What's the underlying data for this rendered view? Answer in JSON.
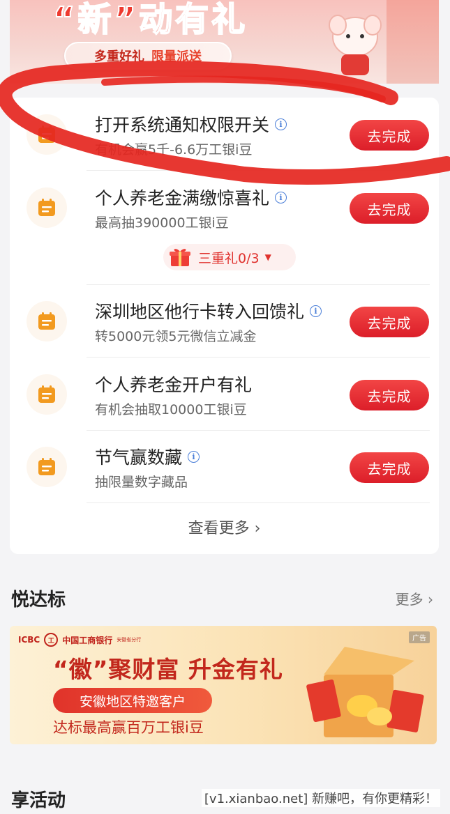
{
  "banner": {
    "title": "“新”动有礼",
    "pill_a": "多重好礼",
    "pill_b": "限量派送"
  },
  "tasks": [
    {
      "title": "打开系统通知权限开关",
      "has_info": true,
      "subtitle": "有机会赢5千-6.6万工银i豆",
      "button": "去完成"
    },
    {
      "title": "个人养老金满缴惊喜礼",
      "has_info": true,
      "subtitle": "最高抽390000工银i豆",
      "button": "去完成"
    },
    {
      "title": "深圳地区他行卡转入回馈礼",
      "has_info": true,
      "subtitle": "转5000元领5元微信立减金",
      "button": "去完成"
    },
    {
      "title": "个人养老金开户有礼",
      "has_info": false,
      "subtitle": "有机会抽取10000工银i豆",
      "button": "去完成"
    },
    {
      "title": "节气赢数藏",
      "has_info": true,
      "subtitle": "抽限量数字藏品",
      "button": "去完成"
    }
  ],
  "gift_progress": {
    "label": "三重礼0/3"
  },
  "see_more": "查看更多",
  "section_yuedabiao": {
    "title": "悦达标",
    "more": "更多"
  },
  "ad": {
    "brand_en": "ICBC",
    "brand_cn": "中国工商银行",
    "brand_branch": "安徽省分行",
    "tag": "广告",
    "headline": "“徽”聚财富 升金有礼",
    "pill": "安徽地区特邀客户",
    "foot": "达标最高赢百万工银i豆"
  },
  "section_activity": {
    "title": "享活动"
  },
  "watermark": "[v1.xianbao.net] 新赚吧，有你更精彩！",
  "colors": {
    "accent_red": "#e8262f",
    "icon_orange": "#f29a1f",
    "info_blue": "#4a7ed8",
    "scribble": "#e52620"
  },
  "icons": {
    "task_icon": "calendar-icon",
    "gift_icon": "gift-box-icon",
    "info_icon": "info-circle-icon",
    "more_icon": "chevron-right-icon"
  }
}
